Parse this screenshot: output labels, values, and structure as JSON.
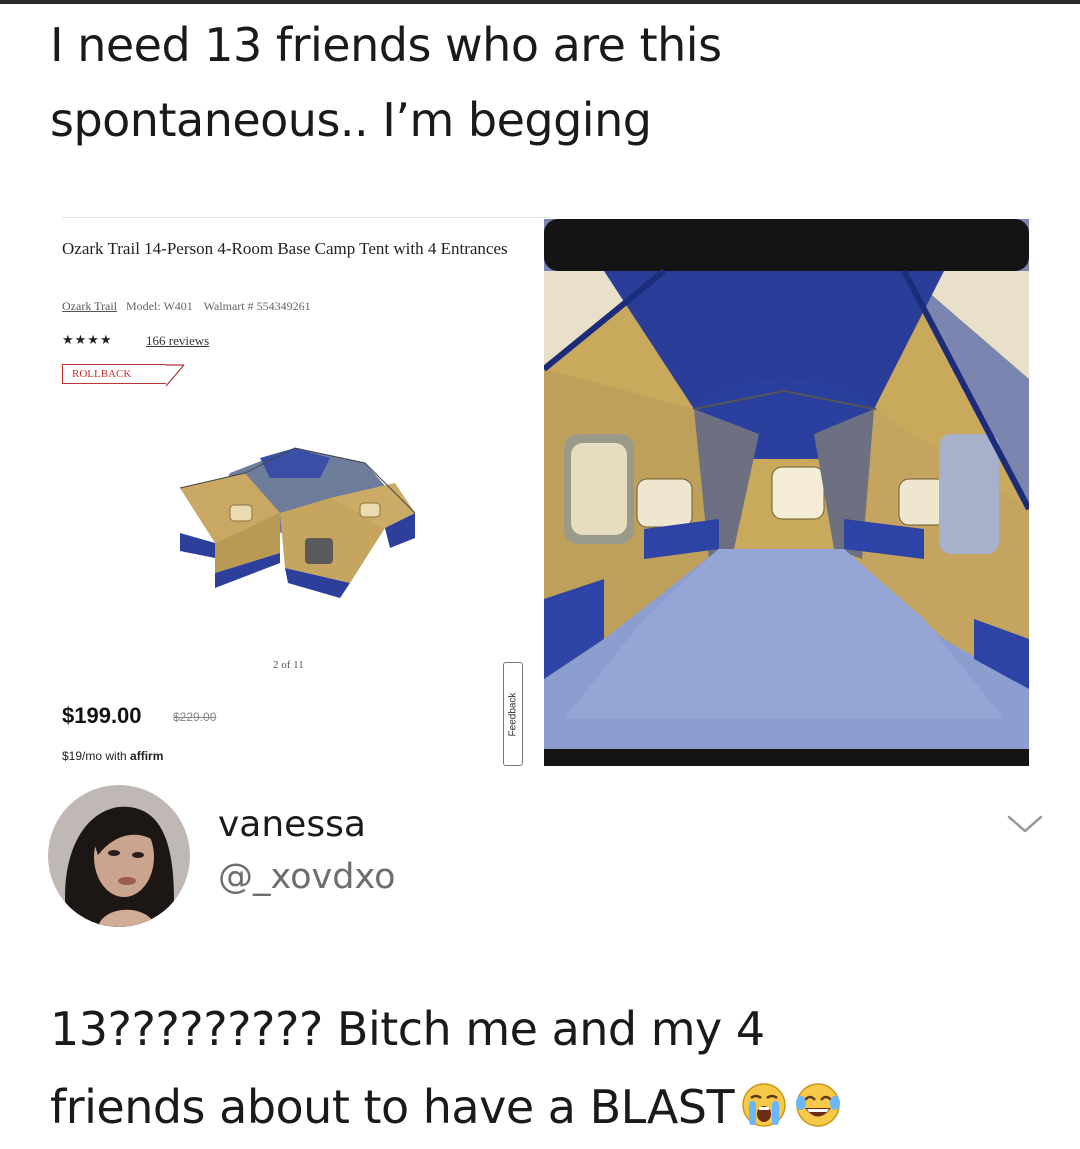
{
  "headline": {
    "line1": "I need 13 friends who are this",
    "line2": "spontaneous.. I’m begging"
  },
  "product": {
    "title": "Ozark Trail 14-Person 4-Room Base Camp Tent with 4 Entrances",
    "brand": "Ozark Trail",
    "model": "Model: W401",
    "walmart_id": "Walmart # 554349261",
    "stars": "★★★★",
    "rating_stars": 4,
    "reviews": "166 reviews",
    "rollback": "ROLLBACK",
    "pager": "2 of 11",
    "price": "$199.00",
    "old_price": "$229.00",
    "affirm_prefix": "$19/mo with ",
    "affirm_brand": "affirm",
    "feedback": "Feedback"
  },
  "tweet": {
    "display_name": "vanessa",
    "handle": "@_xovdxo",
    "line1": "13????????? Bitch me and my 4",
    "line2": "friends about to have a BLAST",
    "emojis": [
      "loudly-crying-face",
      "face-with-tears-of-joy"
    ]
  },
  "colors": {
    "tent_blue": "#2b3f9a",
    "tent_tan": "#c9a75a",
    "floor": "#7f93c4",
    "handle_gray": "#6e6e6e",
    "rollback_red": "#b33333"
  }
}
